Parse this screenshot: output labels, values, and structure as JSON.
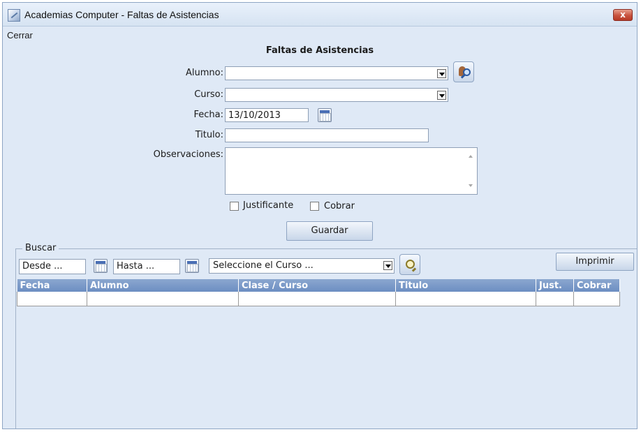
{
  "window": {
    "title": "Academias Computer - Faltas de Asistencias",
    "close_label": "x"
  },
  "menu": {
    "items": [
      "Cerrar"
    ]
  },
  "form": {
    "title": "Faltas de Asistencias",
    "alumno_label": "Alumno:",
    "alumno_value": "",
    "curso_label": "Curso:",
    "curso_value": "",
    "fecha_label": "Fecha:",
    "fecha_value": "13/10/2013",
    "titulo_label": "Titulo:",
    "titulo_value": "",
    "observaciones_label": "Observaciones:",
    "observaciones_value": "",
    "justificante_label": "Justificante",
    "justificante_checked": false,
    "cobrar_label": "Cobrar",
    "cobrar_checked": false,
    "save_label": "Guardar"
  },
  "search": {
    "group_label": "Buscar",
    "desde_value": "Desde ...",
    "hasta_value": "Hasta ...",
    "curso_select_value": "Seleccione el Curso ...",
    "print_label": "Imprimir"
  },
  "grid": {
    "columns": [
      "Fecha",
      "Alumno",
      "Clase / Curso",
      "Titulo",
      "Just.",
      "Cobrar"
    ],
    "rows": [
      [
        "",
        "",
        "",
        "",
        "",
        ""
      ]
    ]
  }
}
